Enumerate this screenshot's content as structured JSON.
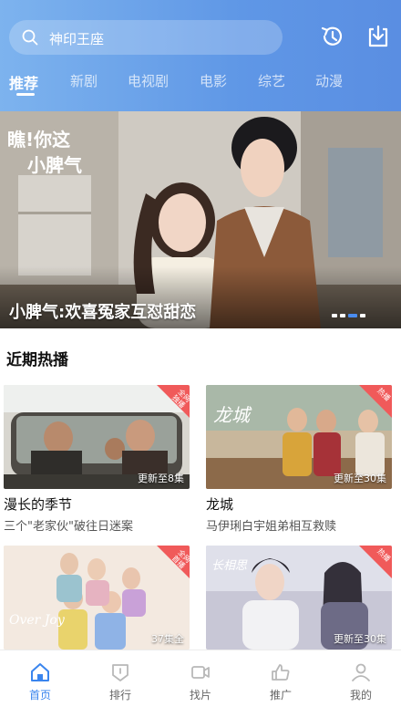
{
  "search": {
    "placeholder_text": "神印王座"
  },
  "header": {
    "history_icon": "history-icon",
    "download_icon": "download-icon"
  },
  "tabs": [
    {
      "label": "推荐",
      "active": true
    },
    {
      "label": "新剧",
      "active": false
    },
    {
      "label": "电视剧",
      "active": false
    },
    {
      "label": "电影",
      "active": false
    },
    {
      "label": "综艺",
      "active": false
    },
    {
      "label": "动漫",
      "active": false
    }
  ],
  "banner": {
    "caption": "小脾气:欢喜冤家互怼甜恋",
    "poster_text_line1": "瞧!你这",
    "poster_text_line2": "小脾气",
    "slide_count": 4,
    "active_slide": 3
  },
  "section": {
    "title": "近期热播"
  },
  "cards": [
    {
      "title": "漫长的季节",
      "subtitle": "三个\"老家伙\"破往日迷案",
      "episode": "更新至8集",
      "badge": "全网\n独播"
    },
    {
      "title": "龙城",
      "subtitle": "马伊琍白宇姐弟相互救赎",
      "episode": "更新至30集",
      "badge": "热播",
      "poster_text": "龙城"
    },
    {
      "title": "",
      "subtitle": "",
      "episode": "37集全",
      "badge": "全网\n首播",
      "poster_text": "Over Joy"
    },
    {
      "title": "",
      "subtitle": "",
      "episode": "更新至30集",
      "badge": "热播",
      "poster_text": "长相思"
    }
  ],
  "bottom_nav": [
    {
      "label": "首页",
      "icon": "home-icon",
      "active": true
    },
    {
      "label": "排行",
      "icon": "ranking-icon",
      "active": false
    },
    {
      "label": "找片",
      "icon": "video-icon",
      "active": false
    },
    {
      "label": "推广",
      "icon": "thumbs-up-icon",
      "active": false
    },
    {
      "label": "我的",
      "icon": "user-icon",
      "active": false
    }
  ],
  "colors": {
    "accent": "#3a85ee",
    "header_start": "#7db3ee",
    "header_end": "#5a8ee2",
    "badge": "#f05a5a"
  }
}
